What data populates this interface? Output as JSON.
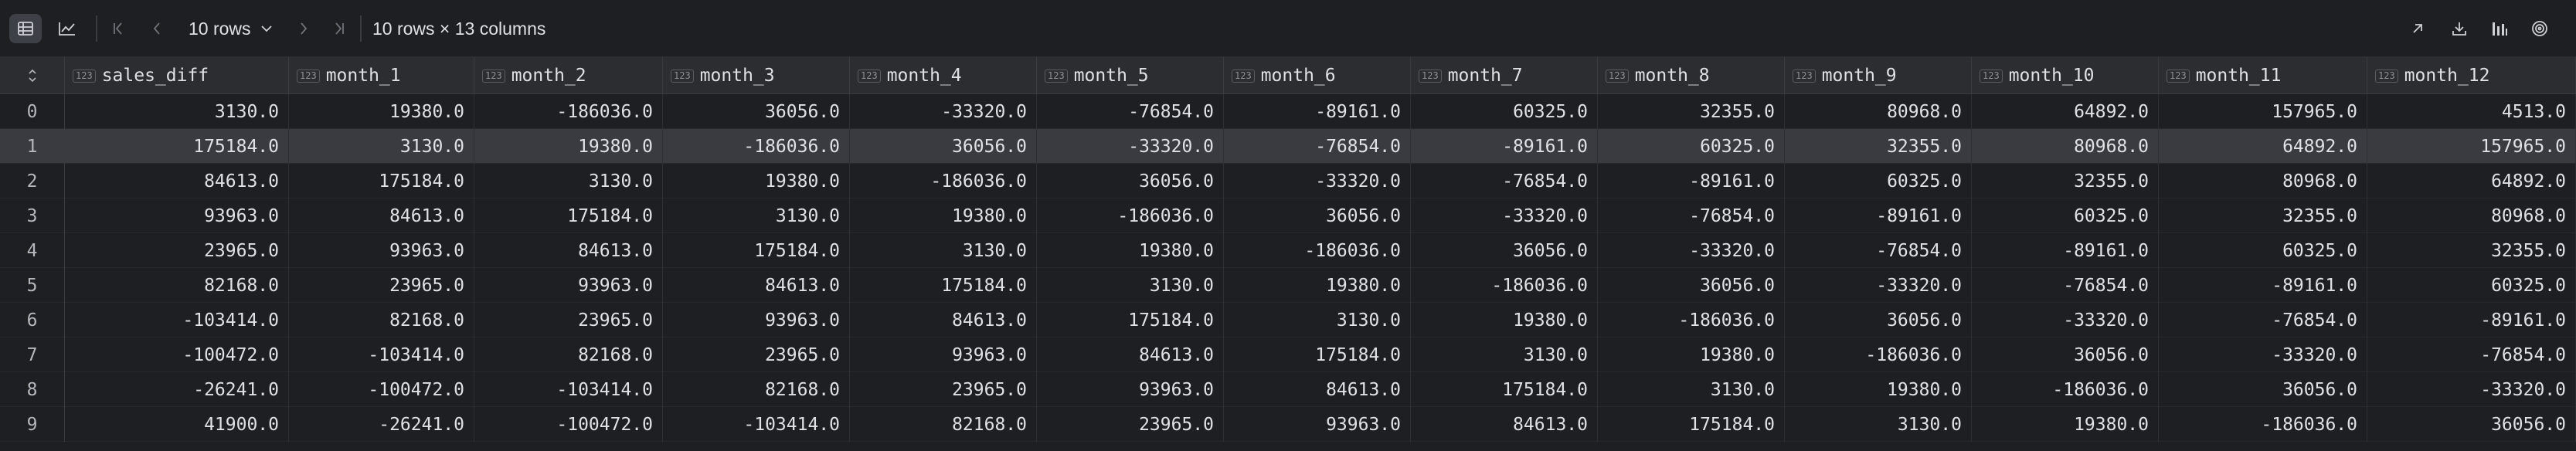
{
  "toolbar": {
    "rows_select": "10 rows",
    "shape_info": "10 rows × 13 columns",
    "icons": [
      "table-view-icon",
      "chart-view-icon",
      "first-page-icon",
      "prev-page-icon",
      "next-page-icon",
      "last-page-icon",
      "open-new-tab-icon",
      "download-icon",
      "column-stats-icon",
      "settings-icon"
    ]
  },
  "table": {
    "columns": [
      {
        "name": "sales_diff",
        "type_badge": "123"
      },
      {
        "name": "month_1",
        "type_badge": "123"
      },
      {
        "name": "month_2",
        "type_badge": "123"
      },
      {
        "name": "month_3",
        "type_badge": "123"
      },
      {
        "name": "month_4",
        "type_badge": "123"
      },
      {
        "name": "month_5",
        "type_badge": "123"
      },
      {
        "name": "month_6",
        "type_badge": "123"
      },
      {
        "name": "month_7",
        "type_badge": "123"
      },
      {
        "name": "month_8",
        "type_badge": "123"
      },
      {
        "name": "month_9",
        "type_badge": "123"
      },
      {
        "name": "month_10",
        "type_badge": "123"
      },
      {
        "name": "month_11",
        "type_badge": "123"
      },
      {
        "name": "month_12",
        "type_badge": "123"
      }
    ],
    "selected_row": 1,
    "rows": [
      {
        "index": "0",
        "cells": [
          "3130.0",
          "19380.0",
          "-186036.0",
          "36056.0",
          "-33320.0",
          "-76854.0",
          "-89161.0",
          "60325.0",
          "32355.0",
          "80968.0",
          "64892.0",
          "157965.0",
          "4513.0"
        ]
      },
      {
        "index": "1",
        "cells": [
          "175184.0",
          "3130.0",
          "19380.0",
          "-186036.0",
          "36056.0",
          "-33320.0",
          "-76854.0",
          "-89161.0",
          "60325.0",
          "32355.0",
          "80968.0",
          "64892.0",
          "157965.0"
        ]
      },
      {
        "index": "2",
        "cells": [
          "84613.0",
          "175184.0",
          "3130.0",
          "19380.0",
          "-186036.0",
          "36056.0",
          "-33320.0",
          "-76854.0",
          "-89161.0",
          "60325.0",
          "32355.0",
          "80968.0",
          "64892.0"
        ]
      },
      {
        "index": "3",
        "cells": [
          "93963.0",
          "84613.0",
          "175184.0",
          "3130.0",
          "19380.0",
          "-186036.0",
          "36056.0",
          "-33320.0",
          "-76854.0",
          "-89161.0",
          "60325.0",
          "32355.0",
          "80968.0"
        ]
      },
      {
        "index": "4",
        "cells": [
          "23965.0",
          "93963.0",
          "84613.0",
          "175184.0",
          "3130.0",
          "19380.0",
          "-186036.0",
          "36056.0",
          "-33320.0",
          "-76854.0",
          "-89161.0",
          "60325.0",
          "32355.0"
        ]
      },
      {
        "index": "5",
        "cells": [
          "82168.0",
          "23965.0",
          "93963.0",
          "84613.0",
          "175184.0",
          "3130.0",
          "19380.0",
          "-186036.0",
          "36056.0",
          "-33320.0",
          "-76854.0",
          "-89161.0",
          "60325.0"
        ]
      },
      {
        "index": "6",
        "cells": [
          "-103414.0",
          "82168.0",
          "23965.0",
          "93963.0",
          "84613.0",
          "175184.0",
          "3130.0",
          "19380.0",
          "-186036.0",
          "36056.0",
          "-33320.0",
          "-76854.0",
          "-89161.0"
        ]
      },
      {
        "index": "7",
        "cells": [
          "-100472.0",
          "-103414.0",
          "82168.0",
          "23965.0",
          "93963.0",
          "84613.0",
          "175184.0",
          "3130.0",
          "19380.0",
          "-186036.0",
          "36056.0",
          "-33320.0",
          "-76854.0"
        ]
      },
      {
        "index": "8",
        "cells": [
          "-26241.0",
          "-100472.0",
          "-103414.0",
          "82168.0",
          "23965.0",
          "93963.0",
          "84613.0",
          "175184.0",
          "3130.0",
          "19380.0",
          "-186036.0",
          "36056.0",
          "-33320.0"
        ]
      },
      {
        "index": "9",
        "cells": [
          "41900.0",
          "-26241.0",
          "-100472.0",
          "-103414.0",
          "82168.0",
          "23965.0",
          "93963.0",
          "84613.0",
          "175184.0",
          "3130.0",
          "19380.0",
          "-186036.0",
          "36056.0"
        ]
      }
    ]
  }
}
